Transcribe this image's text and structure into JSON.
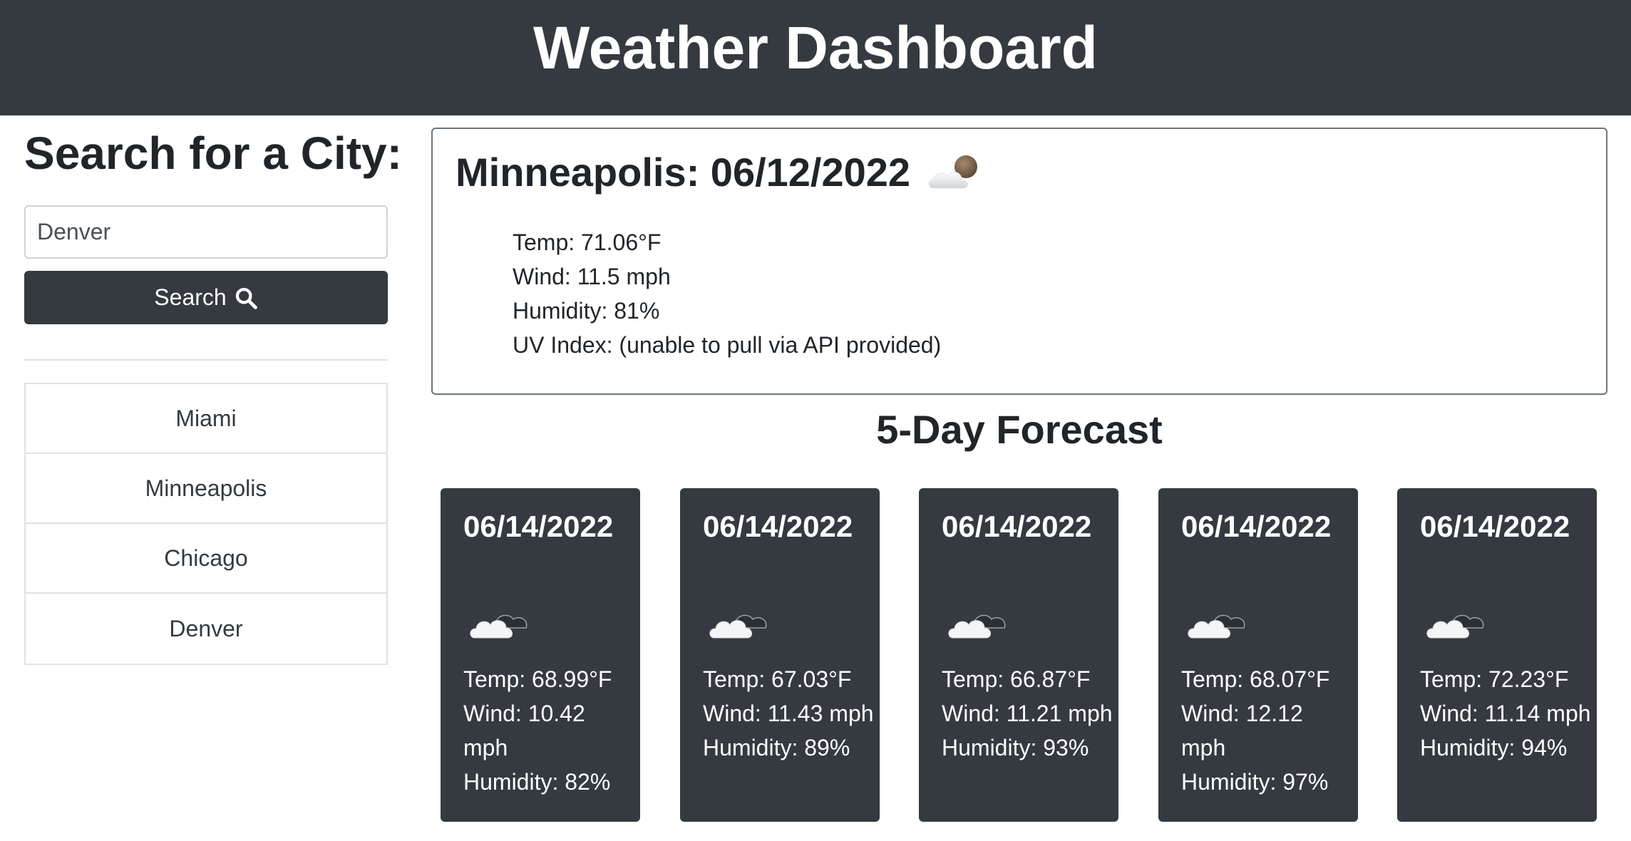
{
  "header": {
    "title": "Weather Dashboard"
  },
  "search": {
    "title": "Search for a City:",
    "input_value": "Denver",
    "button_label": "Search"
  },
  "history": [
    "Miami",
    "Minneapolis",
    "Chicago",
    "Denver"
  ],
  "current": {
    "title": "Minneapolis: 06/12/2022",
    "icon": "partly-cloudy-night-icon",
    "temp": "Temp: 71.06°F",
    "wind": "Wind: 11.5 mph",
    "humidity": "Humidity: 81%",
    "uv": "UV Index: (unable to pull via API provided)"
  },
  "forecast": {
    "title": "5-Day Forecast",
    "days": [
      {
        "date": "06/14/2022",
        "icon": "cloudy-icon",
        "temp": "Temp: 68.99°F",
        "wind": "Wind: 10.42 mph",
        "humidity": "Humidity: 82%"
      },
      {
        "date": "06/14/2022",
        "icon": "cloudy-icon",
        "temp": "Temp: 67.03°F",
        "wind": "Wind: 11.43 mph",
        "humidity": "Humidity: 89%"
      },
      {
        "date": "06/14/2022",
        "icon": "cloudy-icon",
        "temp": "Temp: 66.87°F",
        "wind": "Wind: 11.21 mph",
        "humidity": "Humidity: 93%"
      },
      {
        "date": "06/14/2022",
        "icon": "cloudy-icon",
        "temp": "Temp: 68.07°F",
        "wind": "Wind: 12.12 mph",
        "humidity": "Humidity: 97%"
      },
      {
        "date": "06/14/2022",
        "icon": "cloudy-icon",
        "temp": "Temp: 72.23°F",
        "wind": "Wind: 11.14 mph",
        "humidity": "Humidity: 94%"
      }
    ]
  },
  "colors": {
    "dark": "#343a40",
    "border": "#dee2e6"
  }
}
